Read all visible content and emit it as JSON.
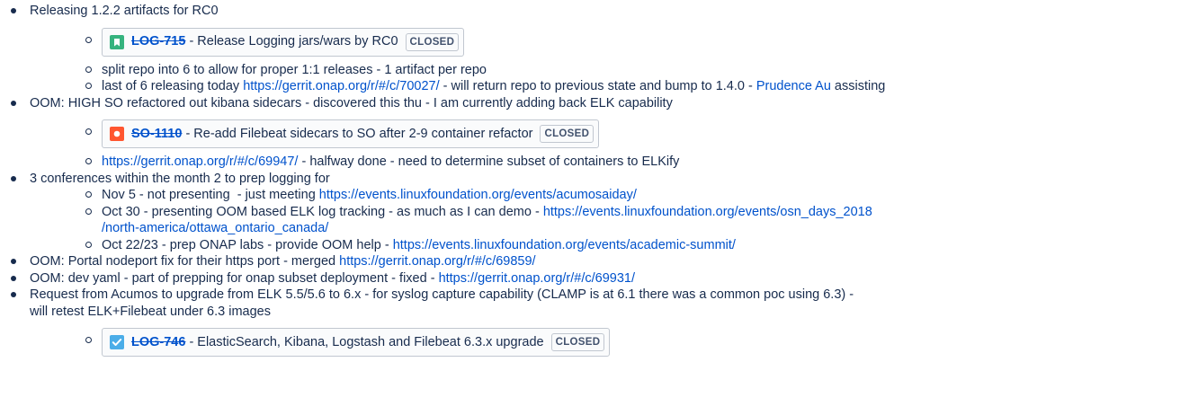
{
  "items": [
    {
      "text": "Releasing 1.2.2 artifacts for RC0",
      "sub": {
        "jira": {
          "key": "LOG-715",
          "summary": "Release Logging jars/wars by RC0",
          "status": "CLOSED",
          "icon": "story-bookmark-icon",
          "icon_color": "#36b37e"
        },
        "line1": "split repo into 6 to allow for proper 1:1 releases - 1 artifact per repo",
        "line2_prefix": "last of 6 releasing today ",
        "line2_link": "https://gerrit.onap.org/r/#/c/70027/",
        "line2_mid": " - will return repo to previous state and bump to 1.4.0 - ",
        "line2_user": "Prudence Au",
        "line2_suffix": " assisting"
      }
    },
    {
      "text": "OOM: HIGH SO refactored out kibana sidecars - discovered this thu - I am currently adding back ELK capability",
      "sub": {
        "jira": {
          "key": "SO-1110",
          "summary": "Re-add Filebeat sidecars to SO after 2-9 container refactor",
          "status": "CLOSED",
          "icon": "bug-icon",
          "icon_color": "#ff5630"
        },
        "line1_link": "https://gerrit.onap.org/r/#/c/69947/",
        "line1_suffix": " - halfway done - need to determine subset of containers to ELKify"
      }
    },
    {
      "text": "3 conferences within the month 2 to prep logging for",
      "sub": {
        "c1_prefix": "Nov 5 - not presenting  - just meeting ",
        "c1_link": "https://events.linuxfoundation.org/events/acumosaiday/",
        "c2_prefix": "Oct 30 - presenting OOM based ELK log tracking - as much as I can demo - ",
        "c2_link_a": "https://events.linuxfoundation.org/events/osn_days_2018",
        "c2_link_b": "/north-america/ottawa_ontario_canada/",
        "c3_prefix": "Oct 22/23 - prep ONAP labs - provide OOM help - ",
        "c3_link": "https://events.linuxfoundation.org/events/academic-summit/"
      }
    },
    {
      "prefix": "OOM: Portal nodeport fix for their https port - merged ",
      "link": "https://gerrit.onap.org/r/#/c/69859/"
    },
    {
      "prefix": "OOM: dev yaml - part of prepping for onap subset deployment - fixed - ",
      "link": "https://gerrit.onap.org/r/#/c/69931/"
    },
    {
      "text_a": "Request from Acumos to upgrade from ELK 5.5/5.6 to 6.x - for syslog capture capability (CLAMP is at 6.1 there was a common poc using 6.3) -",
      "text_b": "will retest ELK+Filebeat under 6.3 images",
      "sub": {
        "jira": {
          "key": "LOG-746",
          "summary": "ElasticSearch, Kibana, Logstash and Filebeat 6.3.x upgrade",
          "status": "CLOSED",
          "icon": "task-checkbox-icon",
          "icon_color": "#4bade8"
        }
      }
    }
  ]
}
